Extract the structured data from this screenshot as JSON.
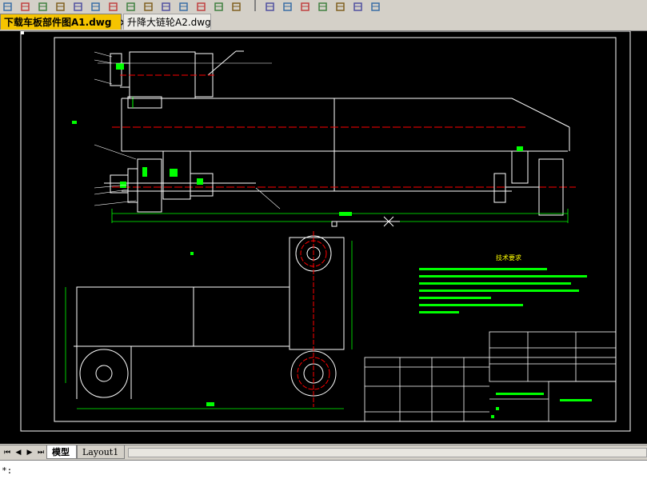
{
  "toolbar": {
    "buttons": [
      "open-icon",
      "save-icon",
      "print-icon",
      "preview-icon",
      "plot-icon",
      "cut-icon",
      "copy-icon",
      "paste-icon",
      "match-icon",
      "undo-icon",
      "redo-icon",
      "pan-icon",
      "zoom-icon",
      "zoom-window-icon",
      "zoom-previous-icon",
      "properties-icon",
      "design-center-icon",
      "tool-palette-icon",
      "distance-icon",
      "point-icon",
      "line-icon"
    ]
  },
  "tabs": [
    {
      "label": "下载车板部件图A1.dwg",
      "active": true,
      "close": "×"
    },
    {
      "label": "升降大链轮A2.dwg",
      "active": false
    }
  ],
  "layout_tabs": [
    {
      "label": "模型",
      "active": true
    },
    {
      "label": "Layout1",
      "active": false
    }
  ],
  "nav": {
    "first": "⏮",
    "prev": "◀",
    "next": "▶",
    "last": "⏭"
  },
  "command_line": {
    "text": "*:"
  },
  "colors": {
    "canvas": "#000000",
    "lines": "#ffffff",
    "green": "#00ff00",
    "red": "#ff0000",
    "yellow": "#ffff00",
    "tab_active": "#f5c400"
  },
  "drawing": {
    "tech_title": "技术要求"
  }
}
